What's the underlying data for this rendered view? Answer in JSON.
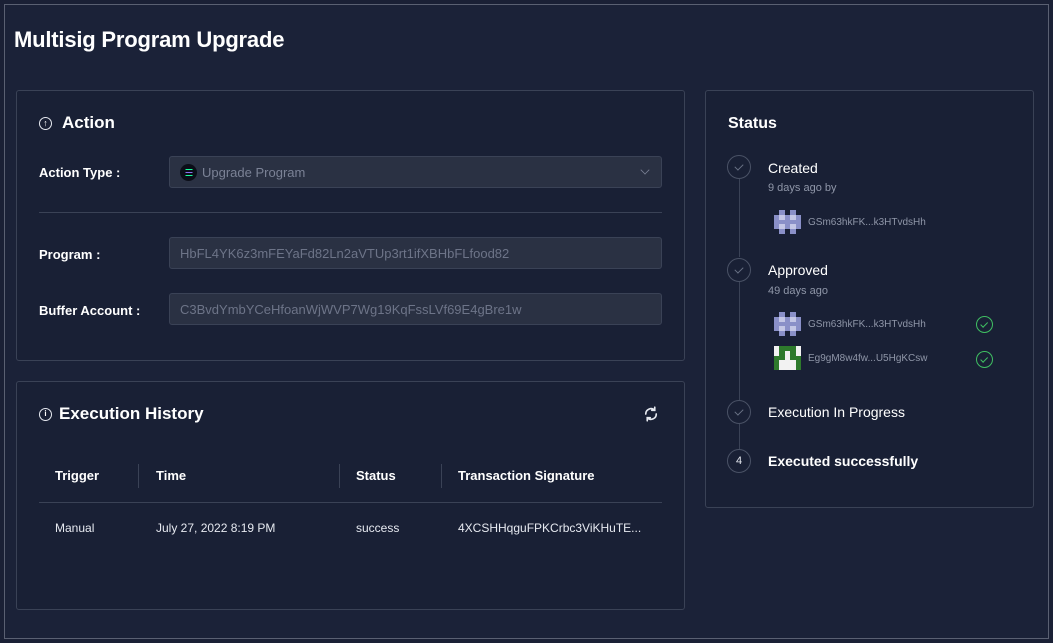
{
  "page": {
    "title": "Multisig Program Upgrade"
  },
  "action": {
    "title": "Action",
    "icon": "circle-arrow-up-icon",
    "action_type_label": "Action Type :",
    "action_type_value": "Upgrade Program",
    "program_label": "Program :",
    "program_value": "HbFL4YK6z3mFEYaFd82Ln2aVTUp3rt1ifXBHbFLfood82",
    "buffer_label": "Buffer Account :",
    "buffer_value": "C3BvdYmbYCeHfoanWjWVP7Wg19KqFssLVf69E4gBre1w"
  },
  "history": {
    "title": "Execution History",
    "icon": "info-icon",
    "refresh_icon": "refresh-icon",
    "columns": [
      "Trigger",
      "Time",
      "Status",
      "Transaction Signature"
    ],
    "rows": [
      {
        "trigger": "Manual",
        "time": "July 27, 2022 8:19 PM",
        "status": "success",
        "signature": "4XCSHHqguFPKCrbc3ViKHuTE..."
      }
    ]
  },
  "status": {
    "title": "Status",
    "steps": [
      {
        "label": "Created",
        "sub": "9 days ago by",
        "state": "done"
      },
      {
        "label": "Approved",
        "sub": "49 days ago",
        "state": "done"
      },
      {
        "label": "Execution In Progress",
        "state": "done"
      },
      {
        "label": "Executed successfully",
        "number": "4",
        "state": "pending"
      }
    ],
    "creator": {
      "address": "GSm63hkFK...k3HTvdsHh"
    },
    "approvers": [
      {
        "address": "GSm63hkFK...k3HTvdsHh",
        "approved": true
      },
      {
        "address": "Eg9gM8w4fw...U5HgKCsw",
        "approved": true
      }
    ],
    "colors": {
      "success": "#3fbf62",
      "avatar_a": "#8a90c8",
      "avatar_b": "#2e7a2c"
    }
  }
}
